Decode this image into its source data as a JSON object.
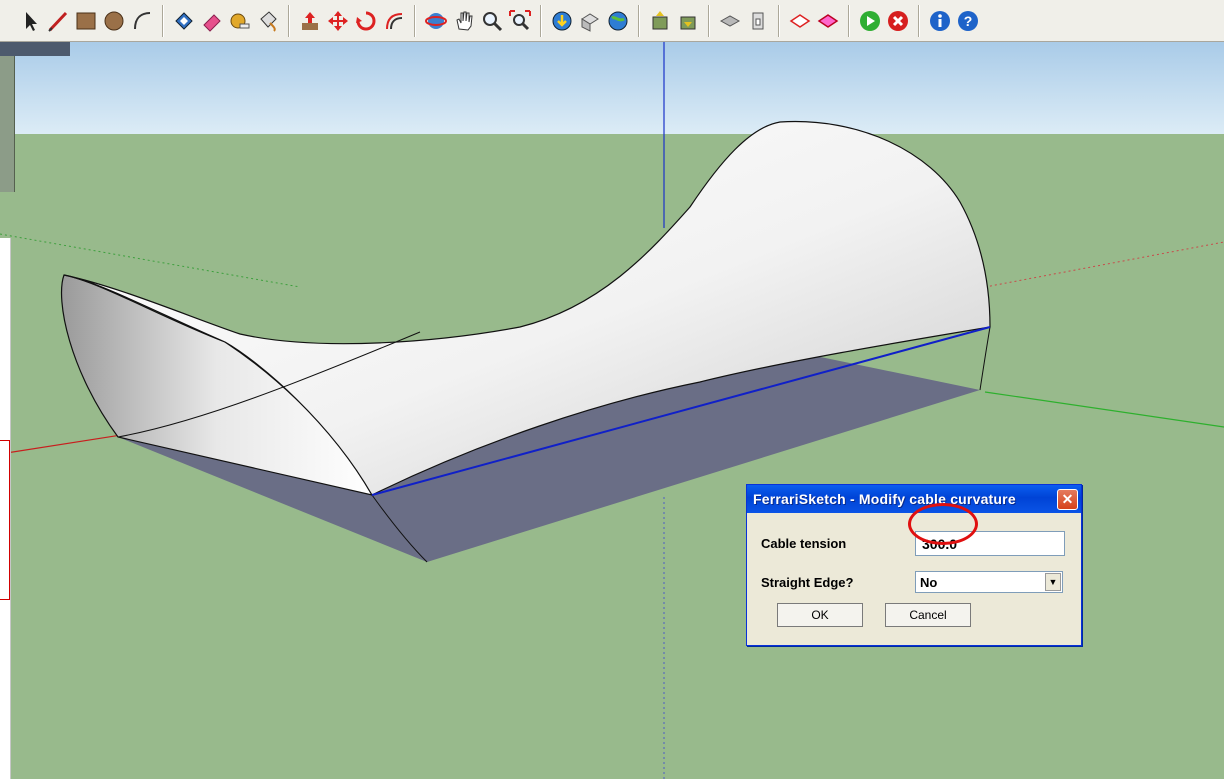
{
  "toolbar": {
    "icons": [
      "select-arrow-icon",
      "pencil-icon",
      "rectangle-icon",
      "circle-icon",
      "arc-icon",
      "make-component-icon",
      "eraser-icon",
      "tape-measure-icon",
      "paint-bucket-icon",
      "push-pull-icon",
      "move-icon",
      "rotate-icon",
      "offset-icon",
      "orbit-icon",
      "pan-icon",
      "zoom-icon",
      "zoom-extents-icon",
      "get-models-icon",
      "share-model-icon",
      "google-earth-icon",
      "import-component-icon",
      "share-component-icon",
      "iso-view-icon",
      "top-view-icon",
      "front-view-icon",
      "right-view-icon",
      "play-icon",
      "stop-icon",
      "info-icon",
      "help-icon"
    ],
    "colors": {
      "bg": "#f0efe9"
    }
  },
  "scene": {
    "sky_color": "#c6dff0",
    "ground_color": "#98ba8c",
    "surface_color": "#ffffff",
    "shadow_color": "#6a6e86"
  },
  "dialog": {
    "title": "FerrariSketch - Modify cable curvature",
    "close_glyph": "✕",
    "tension_label": "Cable tension",
    "tension_value": "300.0",
    "straight_label": "Straight Edge?",
    "straight_value": "No",
    "ok_label": "OK",
    "cancel_label": "Cancel"
  }
}
